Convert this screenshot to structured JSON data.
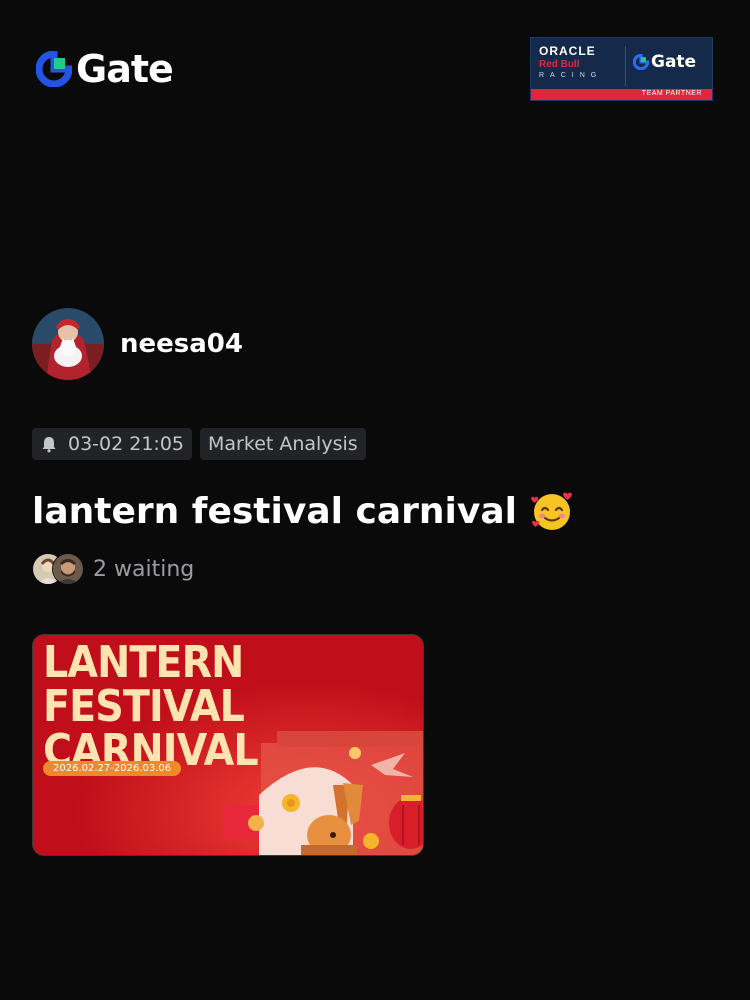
{
  "header": {
    "logo_text": "Gate",
    "partner": {
      "oracle": "ORACLE",
      "redbull": "Red Bull",
      "racing": "RACING",
      "brand": "Gate",
      "strip": "TEAM PARTNER"
    }
  },
  "post": {
    "author": "neesa04",
    "timestamp": "03-02 21:05",
    "category": "Market Analysis",
    "title": "lantern festival carnival",
    "title_emoji": "smiling-face-with-hearts",
    "waiting_text": "2 waiting",
    "banner": {
      "title_line1": "LANTERN FESTIVAL",
      "title_line2": "CARNIVAL",
      "date_range": "2026.02.27-2026.03.06"
    }
  },
  "colors": {
    "background": "#0a0a0a",
    "brand_blue": "#2354e6",
    "brand_green": "#1ecc8b",
    "tag_bg": "#222326",
    "banner_red": "#c8101c"
  },
  "icons": [
    "gate-logo-icon",
    "bell-icon",
    "smiling-face-with-hearts-icon"
  ]
}
